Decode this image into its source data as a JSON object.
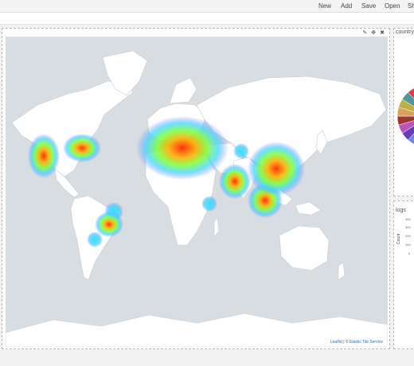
{
  "toolbar": {
    "buttons": [
      {
        "label": "New"
      },
      {
        "label": "Add"
      },
      {
        "label": "Save"
      },
      {
        "label": "Open"
      },
      {
        "label": "Sh"
      }
    ]
  },
  "map_panel": {
    "attribution": {
      "leaflet": "Leaflet",
      "separator": " | © ",
      "service": "Elastic Tile Service"
    },
    "heat_spots": [
      {
        "region": "North America west"
      },
      {
        "region": "North America east"
      },
      {
        "region": "Europe"
      },
      {
        "region": "Middle East"
      },
      {
        "region": "India"
      },
      {
        "region": "Southeast Asia"
      },
      {
        "region": "China"
      },
      {
        "region": "Brazil"
      },
      {
        "region": "Argentina"
      },
      {
        "region": "Madagascar"
      }
    ]
  },
  "pie_panel": {
    "title": "country",
    "slice_colors": [
      "#57c17b",
      "#6f87d8",
      "#663db8",
      "#bc52bc",
      "#9e3533",
      "#daa05d",
      "#bfaf40",
      "#4c9a9b",
      "#e03e46",
      "#8f5a9b"
    ]
  },
  "logs_panel": {
    "title": "logs",
    "y_axis_label": "Count",
    "y_ticks": [
      "400",
      "300",
      "200",
      "100",
      "0"
    ]
  },
  "colors": {
    "land": "#ffffff",
    "ocean": "#d8dde1",
    "heat_low": "#3dd6ff",
    "heat_mid": "#7cff3a",
    "heat_high": "#ff2a00"
  }
}
